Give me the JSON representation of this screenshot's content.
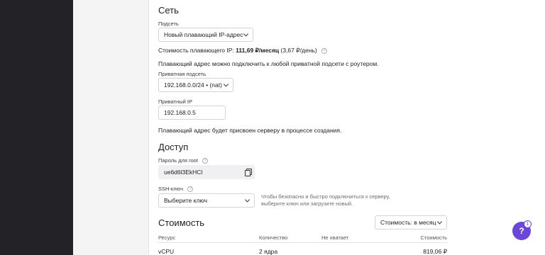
{
  "network": {
    "heading": "Сеть",
    "subnet_label": "Подсеть",
    "subnet_value": "Новый плавающий IP-адрес",
    "cost_prefix": "Стоимость плавающего IP:",
    "cost_strong": "111,69 ₽/месяц",
    "cost_daily": "(3,67 ₽/день)",
    "floating_note": "Плавающий адрес можно подключить к любой приватной подсети с роутером.",
    "private_subnet_label": "Приватная подсеть",
    "private_subnet_value": "192.168.0.0/24 • (nat)",
    "private_ip_label": "Приватный IP",
    "private_ip_value": "192.168.0.5",
    "assign_note": "Плавающий адрес будет присвоен серверу в процессе создания."
  },
  "access": {
    "heading": "Доступ",
    "root_password_label": "Пароль для root",
    "root_password_value": "ue6d6l3EkHCl",
    "ssh_label": "SSH-ключ",
    "ssh_placeholder": "Выберите ключ",
    "ssh_hint": "Чтобы безопасно и быстро подключиться к серверу, выберите ключ или загрузите новый."
  },
  "cost": {
    "heading": "Стоимость",
    "period_select": "Стоимость: в месяц",
    "columns": [
      "Ресурс",
      "Количество",
      "Не хватает",
      "Стоимость"
    ],
    "rows": [
      {
        "resource": "vCPU",
        "quantity": "2 ядра",
        "missing": "",
        "price": "819,06 ₽"
      }
    ]
  },
  "help": {
    "fab_label": "?",
    "badge_count": "1"
  },
  "icons": {
    "help": "question-circle-icon",
    "copy": "copy-icon",
    "chevron": "chevron-down-icon"
  },
  "colors": {
    "sidebar": "#232327",
    "accent": "#6b46d8"
  }
}
